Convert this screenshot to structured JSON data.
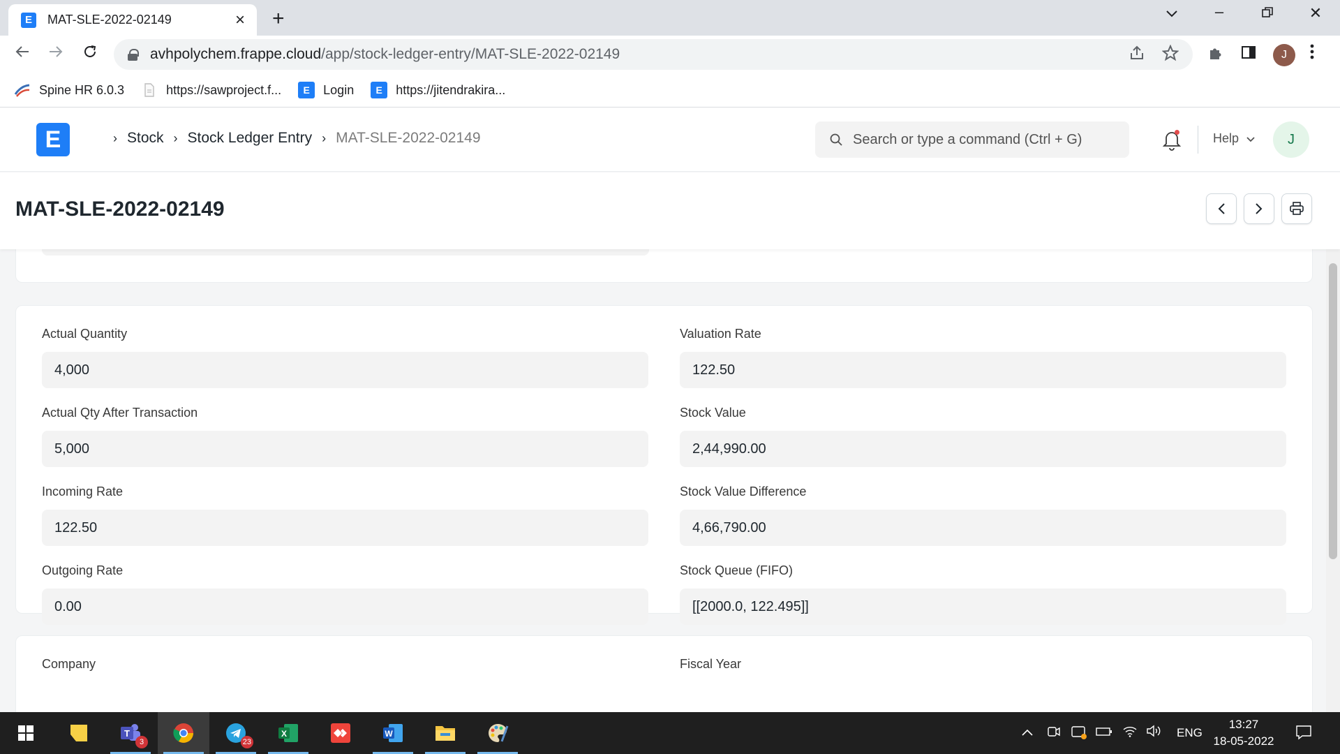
{
  "browser": {
    "tab_title": "MAT-SLE-2022-02149",
    "url_host": "avhpolychem.frappe.cloud",
    "url_path": "/app/stock-ledger-entry/MAT-SLE-2022-02149",
    "profile_initial": "J",
    "bookmarks": [
      {
        "label": "Spine HR 6.0.3",
        "icon": "spine-icon"
      },
      {
        "label": "https://sawproject.f...",
        "icon": "document-icon"
      },
      {
        "label": "Login",
        "icon": "erpnext-icon"
      },
      {
        "label": "https://jitendrakira...",
        "icon": "erpnext-icon"
      }
    ]
  },
  "app": {
    "logo_letter": "E",
    "breadcrumbs": [
      "Stock",
      "Stock Ledger Entry",
      "MAT-SLE-2022-02149"
    ],
    "search_placeholder": "Search or type a command (Ctrl + G)",
    "help_label": "Help",
    "user_initial": "J",
    "page_title": "MAT-SLE-2022-02149"
  },
  "fields": {
    "actual_quantity": {
      "label": "Actual Quantity",
      "value": "4,000"
    },
    "valuation_rate": {
      "label": "Valuation Rate",
      "value": "122.50"
    },
    "actual_qty_after": {
      "label": "Actual Qty After Transaction",
      "value": "5,000"
    },
    "stock_value": {
      "label": "Stock Value",
      "value": "2,44,990.00"
    },
    "incoming_rate": {
      "label": "Incoming Rate",
      "value": "122.50"
    },
    "stock_value_difference": {
      "label": "Stock Value Difference",
      "value": "4,66,790.00"
    },
    "outgoing_rate": {
      "label": "Outgoing Rate",
      "value": "0.00"
    },
    "stock_queue": {
      "label": "Stock Queue (FIFO)",
      "value": "[[2000.0, 122.495]]"
    },
    "company": {
      "label": "Company"
    },
    "fiscal_year": {
      "label": "Fiscal Year"
    }
  },
  "taskbar": {
    "teams_badge": "3",
    "telegram_badge": "23",
    "language": "ENG",
    "time": "13:27",
    "date": "18-05-2022"
  },
  "colors": {
    "brand": "#1e7ef7",
    "taskbar": "#1f1f1f"
  }
}
